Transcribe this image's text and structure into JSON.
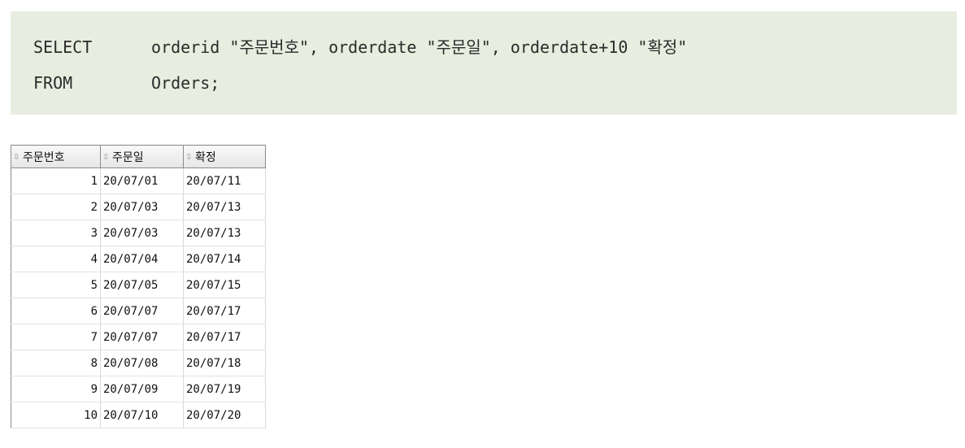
{
  "sql": {
    "line1": {
      "keyword": "SELECT",
      "rest": "orderid \"주문번호\", orderdate \"주문일\", orderdate+10 \"확정\""
    },
    "line2": {
      "keyword": "FROM",
      "rest": "Orders;"
    }
  },
  "grid": {
    "sort_icon": "⇳",
    "icon_name": "sort-toggle-icon",
    "columns": [
      "주문번호",
      "주문일",
      "확정"
    ],
    "rows": [
      [
        "1",
        "20/07/01",
        "20/07/11"
      ],
      [
        "2",
        "20/07/03",
        "20/07/13"
      ],
      [
        "3",
        "20/07/03",
        "20/07/13"
      ],
      [
        "4",
        "20/07/04",
        "20/07/14"
      ],
      [
        "5",
        "20/07/05",
        "20/07/15"
      ],
      [
        "6",
        "20/07/07",
        "20/07/17"
      ],
      [
        "7",
        "20/07/07",
        "20/07/17"
      ],
      [
        "8",
        "20/07/08",
        "20/07/18"
      ],
      [
        "9",
        "20/07/09",
        "20/07/19"
      ],
      [
        "10",
        "20/07/10",
        "20/07/20"
      ]
    ]
  }
}
